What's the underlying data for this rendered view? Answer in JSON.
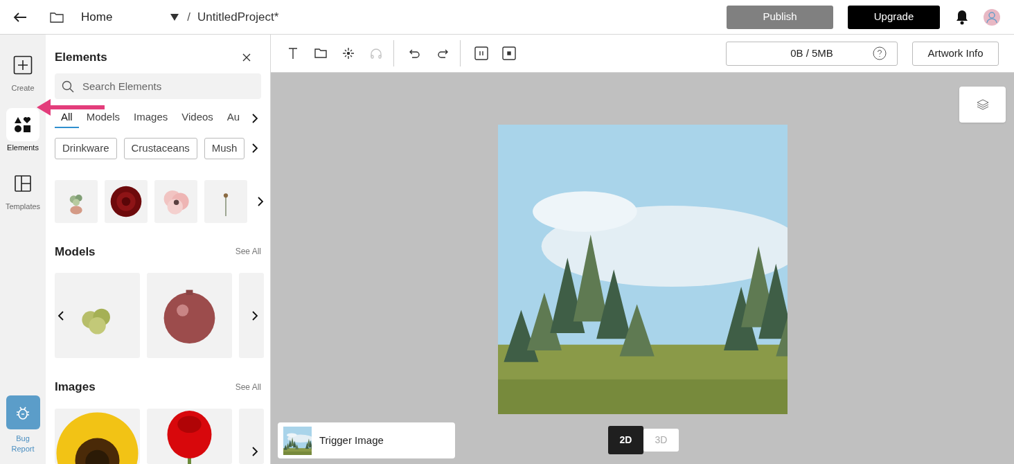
{
  "header": {
    "home": "Home",
    "separator": "/",
    "project": "UntitledProject*",
    "publish": "Publish",
    "upgrade": "Upgrade"
  },
  "rail": {
    "items": [
      {
        "kind": "create",
        "label": "Create",
        "selected": false
      },
      {
        "kind": "elements",
        "label": "Elements",
        "selected": true
      },
      {
        "kind": "templates",
        "label": "Templates",
        "selected": false
      }
    ],
    "bug_report": "Bug Report"
  },
  "panel": {
    "title": "Elements",
    "search": {
      "placeholder": "Search Elements"
    },
    "tabs": [
      {
        "label": "All",
        "selected": true
      },
      {
        "label": "Models",
        "selected": false
      },
      {
        "label": "Images",
        "selected": false
      },
      {
        "label": "Videos",
        "selected": false
      },
      {
        "label": "Au",
        "selected": false
      }
    ],
    "tags": [
      "Drinkware",
      "Crustaceans",
      "Mush"
    ],
    "sections": [
      {
        "title": "Models",
        "see_all": "See All"
      },
      {
        "title": "Images",
        "see_all": "See All"
      }
    ]
  },
  "toolbar": {
    "tools": [
      {
        "kind": "text",
        "disabled": false
      },
      {
        "kind": "folder",
        "disabled": false
      },
      {
        "kind": "sparkle",
        "disabled": false
      },
      {
        "kind": "audio",
        "disabled": true
      },
      {
        "kind": "undo",
        "disabled": false
      },
      {
        "kind": "redo",
        "disabled": false
      },
      {
        "kind": "pause",
        "disabled": false
      },
      {
        "kind": "stop",
        "disabled": false
      }
    ],
    "storage": "0B / 5MB",
    "artwork_info": "Artwork Info"
  },
  "canvas": {
    "trigger": "Trigger Image",
    "view_modes": [
      {
        "label": "2D",
        "selected": true
      },
      {
        "label": "3D",
        "selected": false
      }
    ]
  }
}
